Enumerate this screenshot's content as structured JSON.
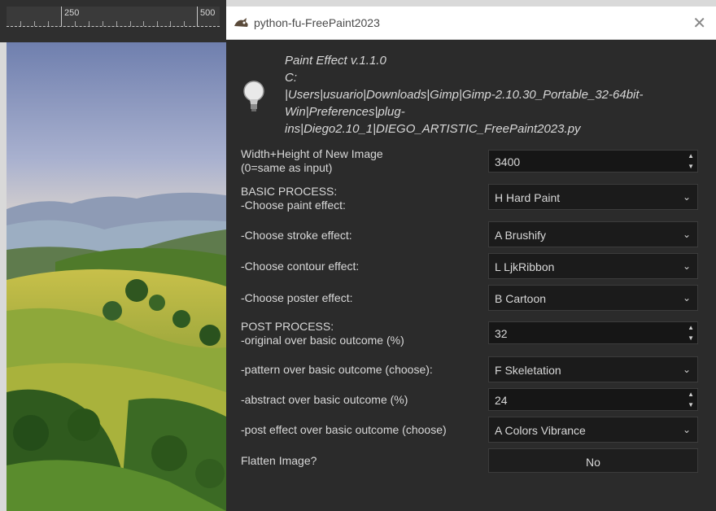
{
  "ruler": {
    "marks": [
      "250",
      "500"
    ]
  },
  "dialog": {
    "title": "python-fu-FreePaint2023",
    "info_lines": [
      "Paint Effect v.1.1.0",
      "C:",
      "|Users|usuario|Downloads|Gimp|Gimp-2.10.30_Portable_32-64bit-",
      "Win|Preferences|plug-",
      "ins|Diego2.10_1|DIEGO_ARTISTIC_FreePaint2023.py"
    ],
    "fields": [
      {
        "label1": "Width+Height of New Image",
        "label2": " (0=same as input)",
        "value": "3400"
      },
      {
        "label1": "BASIC PROCESS:",
        "label2": " -Choose paint effect:",
        "value": "H Hard Paint"
      },
      {
        "label1": " -Choose stroke effect:",
        "value": "A Brushify"
      },
      {
        "label1": " -Choose contour effect:",
        "value": "L LjkRibbon"
      },
      {
        "label1": " -Choose poster effect:",
        "value": "B Cartoon"
      },
      {
        "label1": "POST PROCESS:",
        "label2": " -original over basic outcome (%)",
        "value": "32"
      },
      {
        "label1": "-pattern over basic outcome (choose):",
        "value": "F Skeletation"
      },
      {
        "label1": "-abstract over basic outcome (%)",
        "value": "24"
      },
      {
        "label1": "-post effect over basic outcome (choose)",
        "value": "A Colors Vibrance"
      },
      {
        "label1": "Flatten Image?",
        "value": "No"
      }
    ]
  },
  "icons": {
    "wilber": "gimp-wilber-icon",
    "bulb": "lightbulb-icon",
    "close": "close-icon",
    "chevron": "chevron-down-icon",
    "spin": "spin-arrows-icon"
  },
  "colors": {
    "dialog_bg": "#2b2b2b",
    "control_bg": "#1b1b1b",
    "text": "#d8d8d8"
  }
}
